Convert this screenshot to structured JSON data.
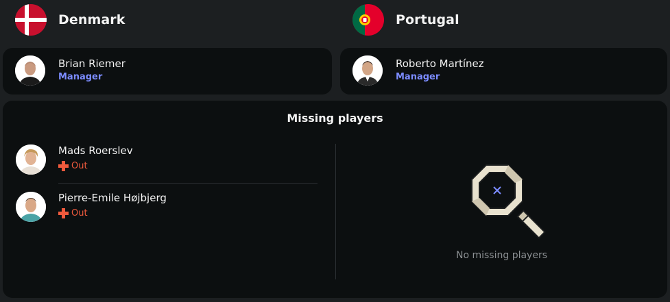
{
  "teams": {
    "home": {
      "name": "Denmark",
      "flag": "denmark-flag",
      "manager": {
        "name": "Brian Riemer",
        "role": "Manager"
      }
    },
    "away": {
      "name": "Portugal",
      "flag": "portugal-flag",
      "manager": {
        "name": "Roberto Martínez",
        "role": "Manager"
      }
    }
  },
  "missing": {
    "title": "Missing players",
    "home_players": [
      {
        "name": "Mads Roerslev",
        "status": "Out",
        "status_icon": "red-cross-icon"
      },
      {
        "name": "Pierre-Emile Højbjerg",
        "status": "Out",
        "status_icon": "red-cross-icon"
      }
    ],
    "away_empty_text": "No missing players",
    "away_empty_icon": "magnifier-icon"
  },
  "colors": {
    "background": "#1c1f21",
    "card": "#0c0f10",
    "role_accent": "#7c8cff",
    "status_out": "#ef5a3d",
    "muted_text": "#8b8f92"
  }
}
